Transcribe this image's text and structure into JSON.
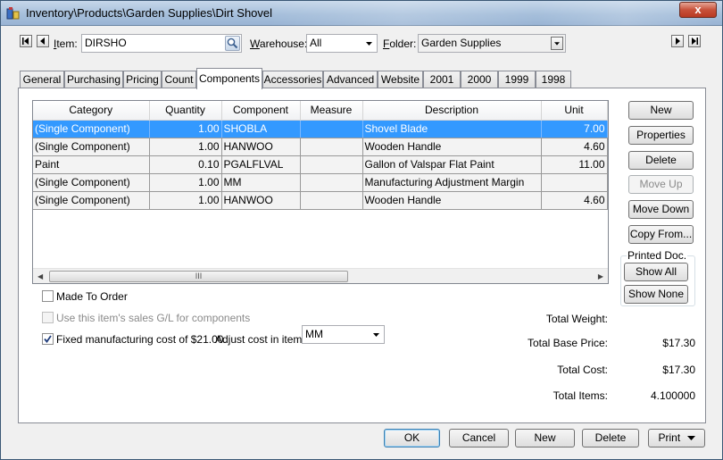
{
  "window": {
    "title": "Inventory\\Products\\Garden Supplies\\Dirt Shovel",
    "close_label": "x"
  },
  "header": {
    "item_label": "Item:",
    "item_value": "DIRSHO",
    "warehouse_label": "Warehouse:",
    "warehouse_value": "All",
    "folder_label": "Folder:",
    "folder_value": "Garden Supplies"
  },
  "tabs": [
    {
      "label": "General"
    },
    {
      "label": "Purchasing"
    },
    {
      "label": "Pricing"
    },
    {
      "label": "Count"
    },
    {
      "label": "Components",
      "active": true
    },
    {
      "label": "Accessories"
    },
    {
      "label": "Advanced"
    },
    {
      "label": "Website"
    },
    {
      "label": "2001"
    },
    {
      "label": "2000"
    },
    {
      "label": "1999"
    },
    {
      "label": "1998"
    }
  ],
  "grid": {
    "columns": [
      "Category",
      "Quantity",
      "Component",
      "Measure",
      "Description",
      "Unit"
    ],
    "rows": [
      {
        "category": "(Single Component)",
        "quantity": "1.00",
        "component": "SHOBLA",
        "measure": "",
        "description": "Shovel Blade",
        "unit": "7.00",
        "selected": true
      },
      {
        "category": "(Single Component)",
        "quantity": "1.00",
        "component": "HANWOO",
        "measure": "",
        "description": "Wooden Handle",
        "unit": "4.60"
      },
      {
        "category": "Paint",
        "quantity": "0.10",
        "component": "PGALFLVAL",
        "measure": "",
        "description": "Gallon of Valspar Flat Paint",
        "unit": "11.00"
      },
      {
        "category": "(Single Component)",
        "quantity": "1.00",
        "component": "MM",
        "measure": "",
        "description": "Manufacturing Adjustment Margin",
        "unit": ""
      },
      {
        "category": "(Single Component)",
        "quantity": "1.00",
        "component": "HANWOO",
        "measure": "",
        "description": "Wooden Handle",
        "unit": "4.60"
      }
    ],
    "scroll_grip": "III"
  },
  "side_buttons": {
    "new": "New",
    "properties": "Properties",
    "delete": "Delete",
    "move_up": "Move Up",
    "move_down": "Move Down",
    "copy_from": "Copy From..."
  },
  "printed_doc": {
    "caption": "Printed Doc.",
    "show_all": "Show All",
    "show_none": "Show None"
  },
  "options": {
    "made_to_order": "Made To Order",
    "use_sales_gl": "Use this item's sales G/L for components",
    "fixed_cost": "Fixed manufacturing cost of $21.00.",
    "adjust_label": "Adjust cost in item:",
    "adjust_value": "MM"
  },
  "totals": {
    "weight_label": "Total Weight:",
    "weight_value": "",
    "base_price_label": "Total Base Price:",
    "base_price_value": "$17.30",
    "cost_label": "Total Cost:",
    "cost_value": "$17.30",
    "items_label": "Total Items:",
    "items_value": "4.100000"
  },
  "footer": {
    "ok": "OK",
    "cancel": "Cancel",
    "new": "New",
    "delete": "Delete",
    "print": "Print"
  },
  "colors": {
    "selection": "#3399ff",
    "title_bar": "#a6bfdb",
    "close_button": "#c8513a"
  }
}
